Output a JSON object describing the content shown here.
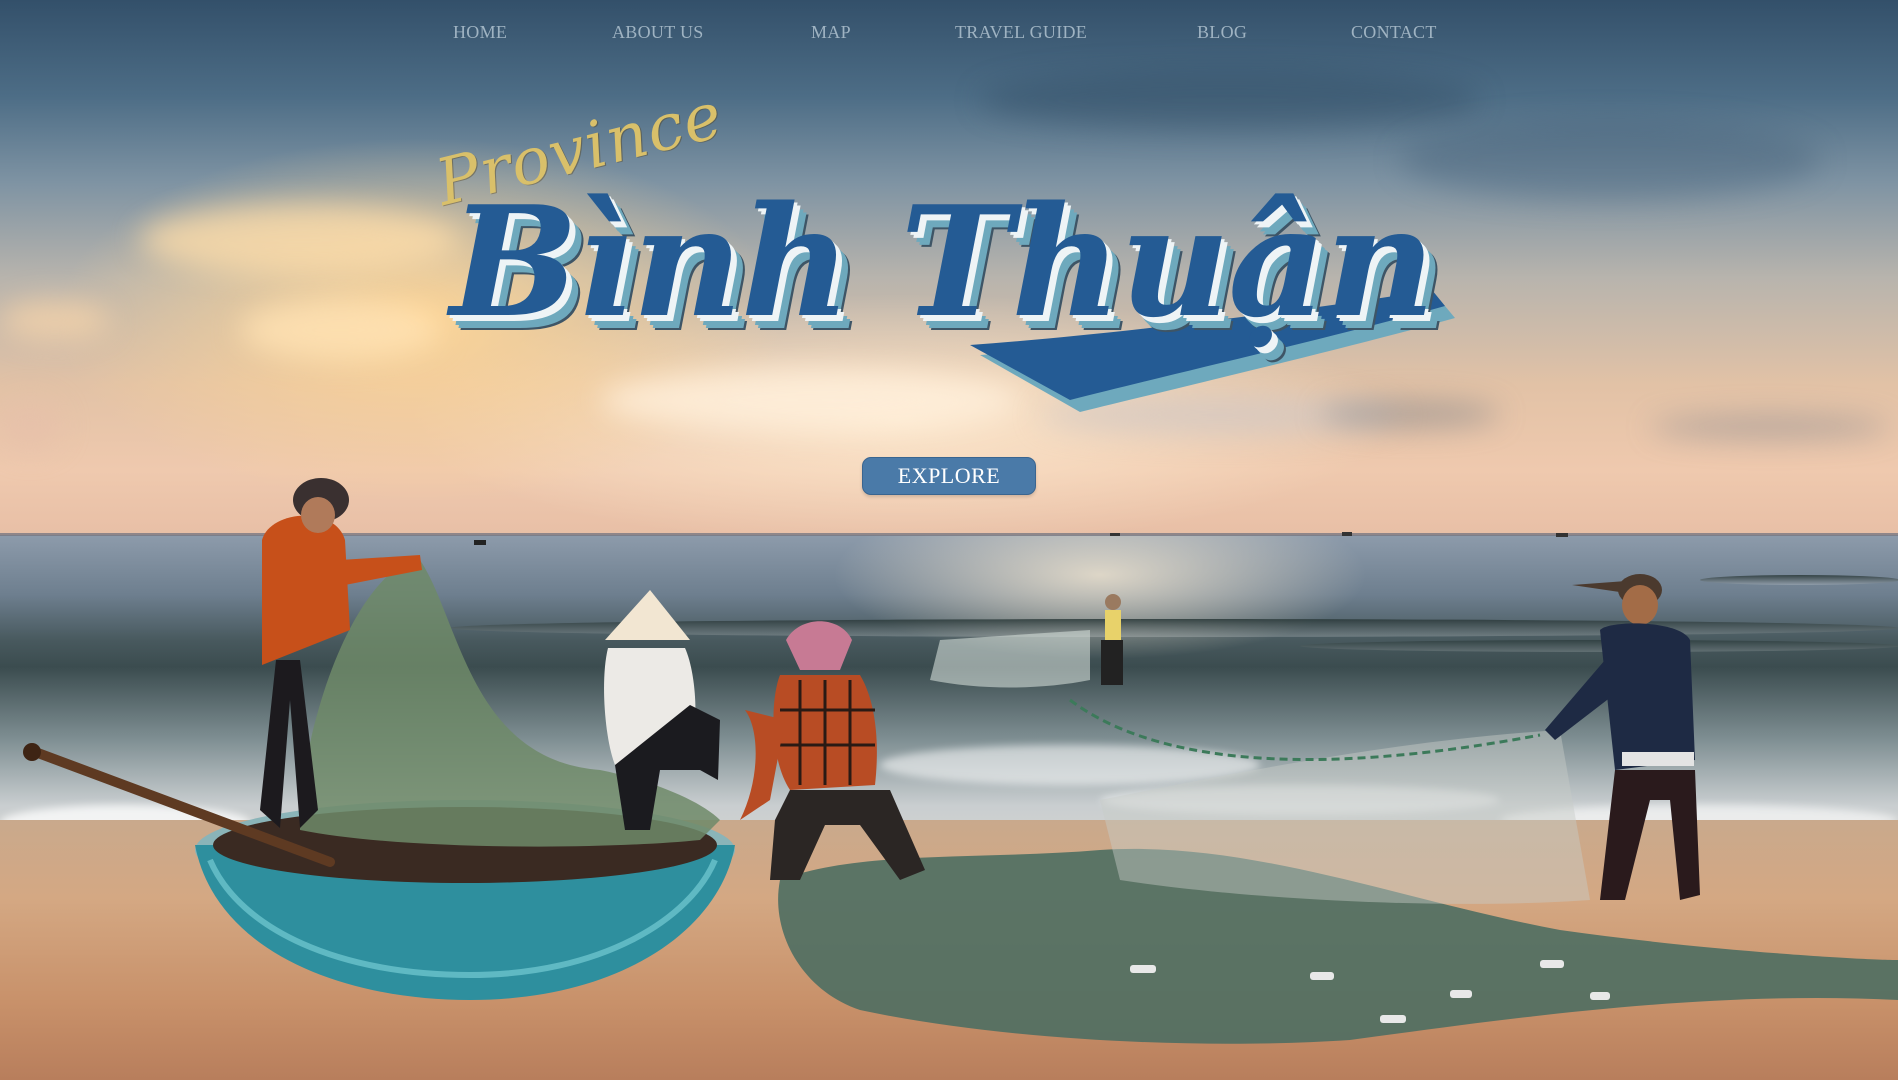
{
  "nav": {
    "items": [
      {
        "label": "HOME"
      },
      {
        "label": "ABOUT US"
      },
      {
        "label": "MAP"
      },
      {
        "label": "TRAVEL GUIDE"
      },
      {
        "label": "BLOG"
      },
      {
        "label": "CONTACT"
      }
    ]
  },
  "hero": {
    "eyebrow": "Province",
    "title": "Bình Thuận",
    "cta_label": "EXPLORE"
  },
  "colors": {
    "nav_text": "#9fb3c2",
    "title_blue": "#245b94",
    "title_shadow": "#6ea9bd",
    "eyebrow_gold": "#d9c06a",
    "button_bg": "#4a7aa8"
  }
}
